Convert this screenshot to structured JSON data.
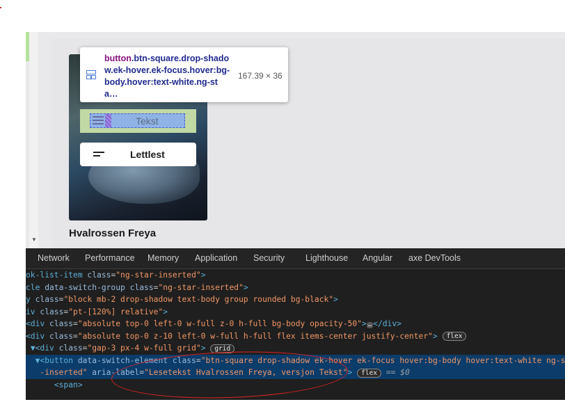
{
  "page": {
    "card_title": "Hvalrossen Freya",
    "btn_tekst_label": "Tekst",
    "btn_lettlest_label": "Lettlest"
  },
  "tooltip": {
    "tag": "button",
    "classes": ".btn-square.drop-shadow.ek-hover.ek-focus.hover:bg-body.hover:text-white.ng-sta…",
    "dimensions": "167.39 × 36"
  },
  "devtools": {
    "tabs": [
      "Network",
      "Performance",
      "Memory",
      "Application",
      "Security",
      "Lighthouse",
      "Angular",
      "axe DevTools"
    ],
    "lines": [
      {
        "pre": "ok-list-item ",
        "attr": "class",
        "val": "\"ng-star-inserted\"",
        "post": ">"
      },
      {
        "pre": "cle ",
        "attr": "data-switch-group class",
        "val": "\"ng-star-inserted\"",
        "post": ">"
      },
      {
        "pre": "y ",
        "attr": "class",
        "val": "\"block mb-2 drop-shadow text-body group rounded bg-black\"",
        "post": ">"
      },
      {
        "pre": "iv ",
        "attr": "class",
        "val": "\"pt-[120%] relative\"",
        "post": ">"
      },
      {
        "pre": "<div ",
        "attr": "class",
        "val": "\"absolute top-0 left-0 w-full z-0 h-full bg-body opacity-50\"",
        "post": ">",
        "ell": "…",
        "close": "</div>"
      },
      {
        "pre": "<div ",
        "attr": "class",
        "val": "\"absolute top-0 z-10 left-0 w-full h-full flex items-center justify-center\"",
        "post": ">",
        "badge": "flex"
      },
      {
        "pre": "▼<div ",
        "attr": "class",
        "val": "\"gap-3 px-4 w-full grid\"",
        "post": ">",
        "badge": "grid"
      },
      {
        "pre": "▼<button ",
        "attr": "data-switch-element class",
        "val": "\"btn-square drop-shadow ek-hover ek-focus hover:bg-body hover:text-white ng-star",
        "post": ""
      },
      {
        "pre": "",
        "attr": "",
        "val": "-inserted\"",
        "post": "",
        "attr2": " aria-label",
        "val2": "\"Lesetekst Hvalrossen Freya, versjon Tekst\"",
        "post2": ">",
        "badge": "flex",
        "eq": "==",
        "dollar": "$0"
      },
      {
        "pre": "<span>",
        "attr": "",
        "val": "",
        "post": ""
      }
    ]
  },
  "colors": {
    "devtools_bg": "#1f1f1f",
    "selected_row": "#0b3c6a",
    "annotation_circle": "#e02424",
    "highlight_padding": "#c1d9a4",
    "highlight_content": "#8fb3e6"
  }
}
